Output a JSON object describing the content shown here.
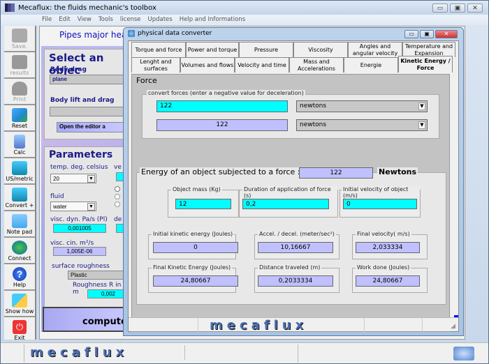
{
  "app": {
    "title": "Mecaflux: the fluids mechanic's toolbox",
    "window_buttons": [
      "minimize",
      "maximize",
      "close"
    ],
    "menu": [
      "File",
      "Edit",
      "View",
      "Tools",
      "license",
      "Updates",
      "Help and Informations"
    ]
  },
  "toolbar": [
    {
      "label": "Save.",
      "icon": "save-icon",
      "enabled": false
    },
    {
      "label": "results",
      "icon": "results-icon",
      "enabled": false
    },
    {
      "label": "Print",
      "icon": "print-icon",
      "enabled": false
    },
    {
      "label": "Reset",
      "icon": "reset-icon",
      "enabled": true
    },
    {
      "label": "Calc",
      "icon": "calculator-icon",
      "enabled": true
    },
    {
      "label": "US/metric",
      "icon": "computer-icon",
      "enabled": true
    },
    {
      "label": "Convert +",
      "icon": "computer-icon",
      "enabled": true
    },
    {
      "label": "Note pad",
      "icon": "notepad-icon",
      "enabled": true
    },
    {
      "label": "Connect",
      "icon": "globe-icon",
      "enabled": true
    },
    {
      "label": "Help",
      "icon": "help-icon",
      "enabled": true
    },
    {
      "label": "Show how",
      "icon": "show-how-icon",
      "enabled": true
    },
    {
      "label": "Exit",
      "icon": "power-icon",
      "enabled": true
    }
  ],
  "main": {
    "header": "Pipes major head los",
    "select_object": {
      "title": "Select an objec",
      "body_drag_label": "Body drag",
      "body_drag_value": "plane",
      "body_lift_label": "Body lift and drag",
      "body_lift_value": "",
      "editor_button": "Open the editor a"
    },
    "parameters": {
      "title": "Parameters",
      "temp_label": "temp. deg. celsius",
      "temp_value": "20",
      "fluid_label": "fluid",
      "fluid_value": "water",
      "visc_dyn_label": "visc. dyn. Pa/s  (Pl)",
      "visc_dyn_value": "0,001005",
      "visc_cin_label": "visc. cin. m²/s",
      "visc_cin_value": "1,005E-06",
      "ve_label": "ve",
      "de_label": "de",
      "surface_label": "surface roughness",
      "surface_value": "Plastic",
      "roughness_label": "Roughness R in m",
      "roughness_value": "0,002"
    },
    "compute_button": "compute",
    "logo": "mecaflux"
  },
  "dialog": {
    "title": "physical data converter",
    "tabs_row1": [
      "Torque and force",
      "Power and torque",
      "Pressure",
      "Viscosity",
      "Angles and angular velocity",
      "Temperature and Expansion"
    ],
    "tabs_row2": [
      "Lenght and surfaces",
      "Volumes and flows",
      "Velocity and time",
      "Mass and Accelerations",
      "Energie",
      "Kinetic Energy / Force"
    ],
    "active_tab": "Kinetic Energy / Force",
    "force_section": "Force",
    "convert_legend": "convert  forces    (enter a negative value for deceleration)",
    "input_value": "122",
    "input_unit": "newtons",
    "output_value": "122",
    "output_unit": "newtons",
    "energy_title": "Energy of an object subjected to a force :",
    "energy_force": "122",
    "energy_unit": "Newtons",
    "inputs": [
      {
        "label": "Object mass (Kg)",
        "value": "12"
      },
      {
        "label": "Duration of application of force (s)",
        "value": "0,2"
      },
      {
        "label": "Initial velocity of object (m/s)",
        "value": "0"
      }
    ],
    "results": [
      {
        "label": "Initial kinetic energy (Joules)",
        "value": "0"
      },
      {
        "label": "Accel. / decel.  (meter/sec²)",
        "value": "10,16667"
      },
      {
        "label": "Final velocity( m/s)",
        "value": "2,033334"
      },
      {
        "label": "Final Kinetic Energy (Joules)",
        "value": "24,80667"
      },
      {
        "label": "Distance traveled (m)",
        "value": "0,2033334"
      },
      {
        "label": "Work done (Joules)",
        "value": "24,80667"
      }
    ],
    "logo": "mecaflux"
  },
  "status": {
    "logo": "mecaflux"
  }
}
